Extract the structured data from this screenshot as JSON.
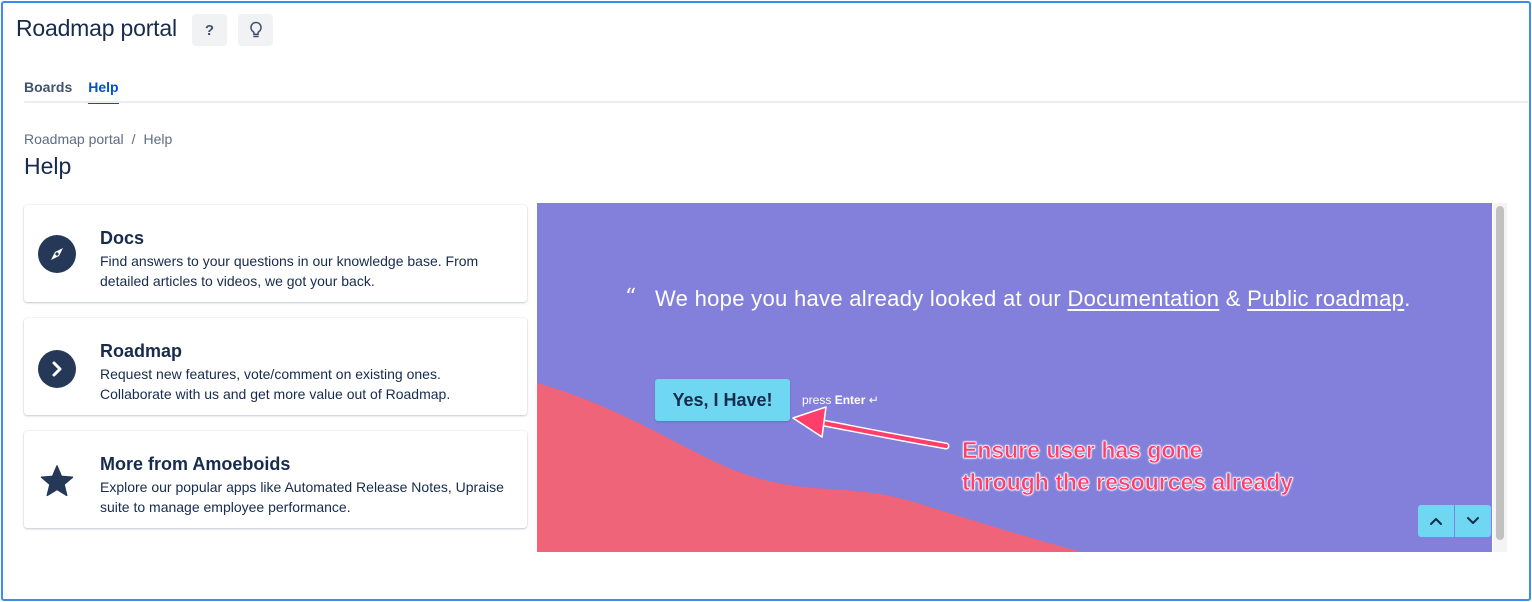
{
  "header": {
    "title": "Roadmap portal",
    "help_button_label": "?",
    "idea_icon": "lightbulb-icon"
  },
  "tabs": [
    {
      "label": "Boards",
      "active": false
    },
    {
      "label": "Help",
      "active": true
    }
  ],
  "breadcrumb": {
    "items": [
      "Roadmap portal",
      "Help"
    ],
    "separator": "/"
  },
  "page_title": "Help",
  "cards": [
    {
      "icon": "compass-icon",
      "title": "Docs",
      "description": "Find answers to your questions in our knowledge base. From detailed articles to videos, we got your back."
    },
    {
      "icon": "chevron-right-icon",
      "title": "Roadmap",
      "description": "Request new features, vote/comment on existing ones. Collaborate with us and get more value out of Roadmap."
    },
    {
      "icon": "star-icon",
      "title": "More from Amoeboids",
      "description": "Explore our popular apps like Automated Release Notes, Upraise suite to manage employee performance."
    }
  ],
  "embed": {
    "quote_mark": "“",
    "quote_prefix": "We hope you have already looked at our ",
    "link_documentation": "Documentation",
    "quote_and": " & ",
    "link_public_roadmap": "Public roadmap",
    "quote_suffix": ".",
    "button_label": "Yes, I Have!",
    "press_label": "press",
    "press_key": "Enter",
    "press_symbol": "↵",
    "colors": {
      "background": "#8280da",
      "wave": "#ef6479",
      "button": "#6fd7f2"
    }
  },
  "annotation": {
    "line1": "Ensure user has gone",
    "line2": "through the resources already",
    "color": "#ff3e6c"
  },
  "colors": {
    "frame": "#3b8ee8",
    "primary": "#0052cc",
    "text": "#172b4d"
  }
}
